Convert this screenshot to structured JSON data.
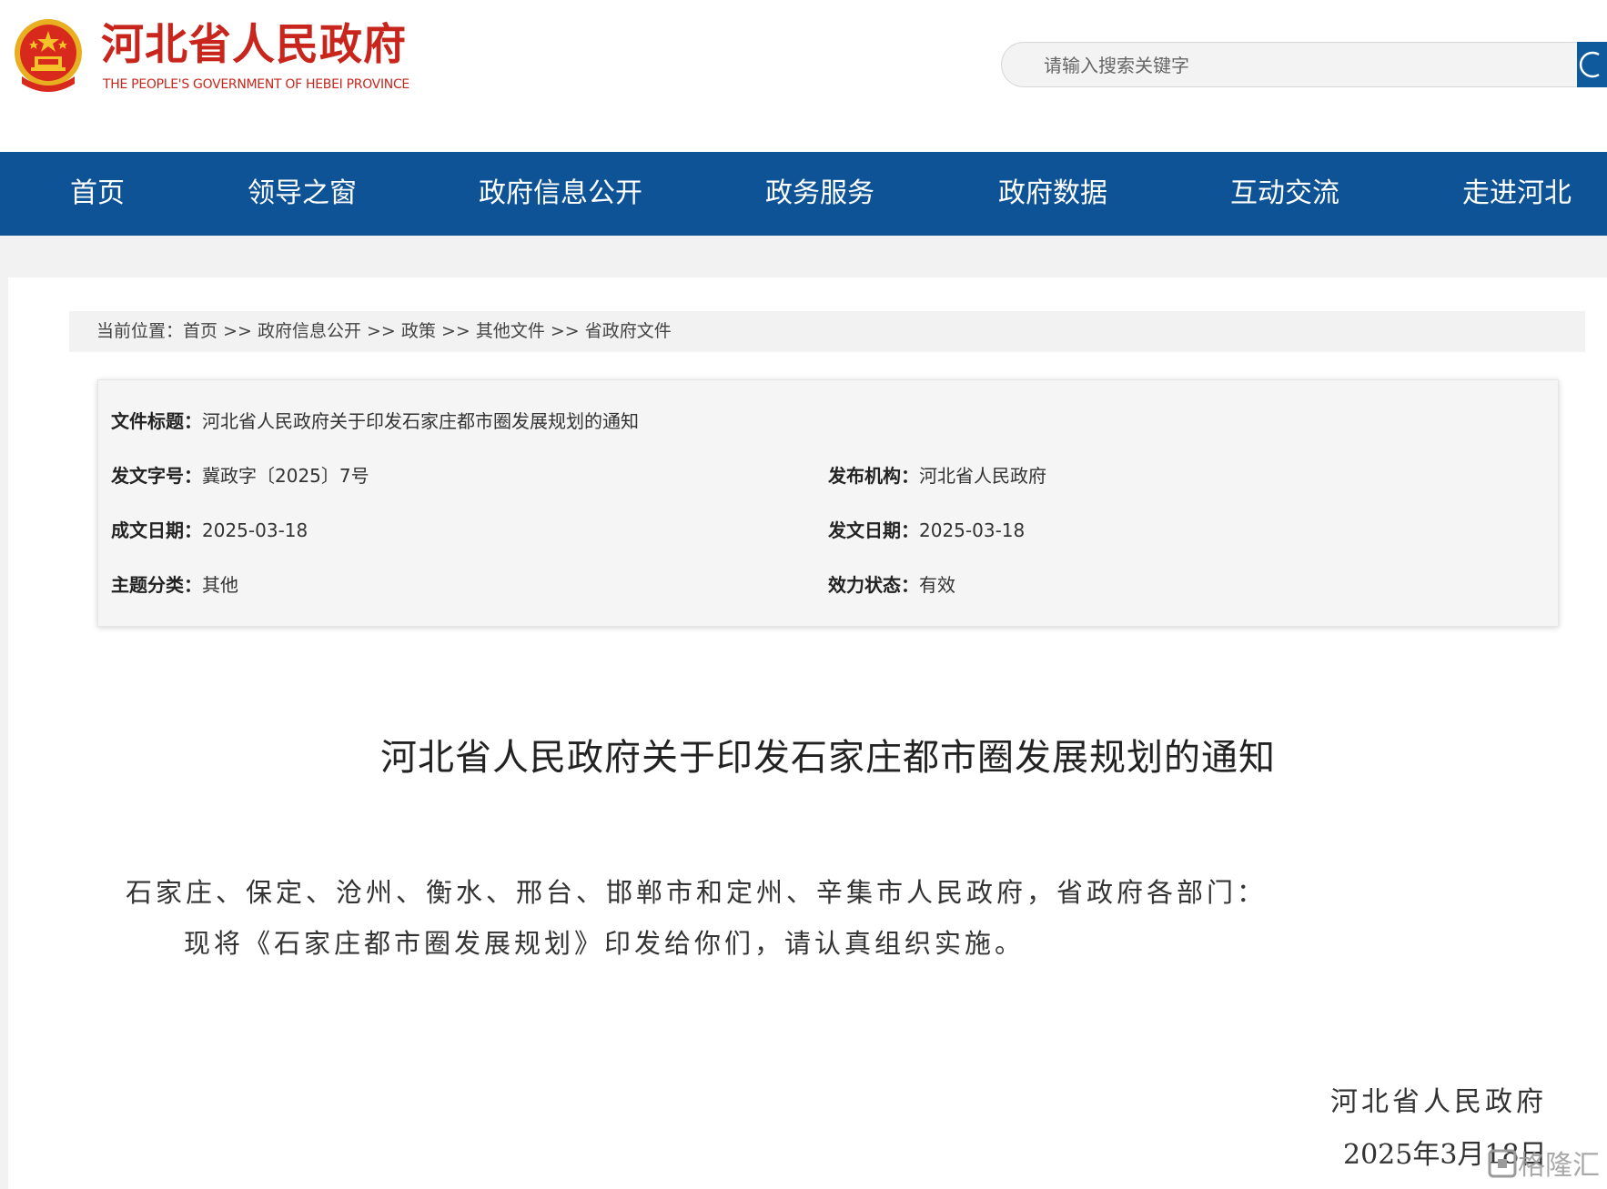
{
  "header": {
    "title": "河北省人民政府",
    "subtitle": "THE PEOPLE'S GOVERNMENT OF HEBEI PROVINCE",
    "search_placeholder": "请输入搜索关键字"
  },
  "nav": {
    "items": [
      "首页",
      "领导之窗",
      "政府信息公开",
      "政务服务",
      "政府数据",
      "互动交流",
      "走进河北"
    ]
  },
  "breadcrumb": {
    "prefix": "当前位置：",
    "items": [
      "首页",
      "政府信息公开",
      "政策",
      "其他文件",
      "省政府文件"
    ],
    "separator": " >> "
  },
  "info": {
    "title_label": "文件标题：",
    "title_value": "河北省人民政府关于印发石家庄都市圈发展规划的通知",
    "doc_no_label": "发文字号：",
    "doc_no_value": "冀政字〔2025〕7号",
    "issuer_label": "发布机构：",
    "issuer_value": "河北省人民政府",
    "written_date_label": "成文日期：",
    "written_date_value": "2025-03-18",
    "publish_date_label": "发文日期：",
    "publish_date_value": "2025-03-18",
    "topic_label": "主题分类：",
    "topic_value": "其他",
    "status_label": "效力状态：",
    "status_value": "有效"
  },
  "document": {
    "title": "河北省人民政府关于印发石家庄都市圈发展规划的通知",
    "addressee": "石家庄、保定、沧州、衡水、邢台、邯郸市和定州、辛集市人民政府，省政府各部门：",
    "body": "现将《石家庄都市圈发展规划》印发给你们，请认真组织实施。",
    "signer": "河北省人民政府",
    "date": "2025年3月18日"
  },
  "watermark": {
    "text": "格隆汇"
  },
  "colors": {
    "brand_red": "#c8261c",
    "nav_blue": "#0e5396",
    "search_button": "#0e5a9c"
  }
}
